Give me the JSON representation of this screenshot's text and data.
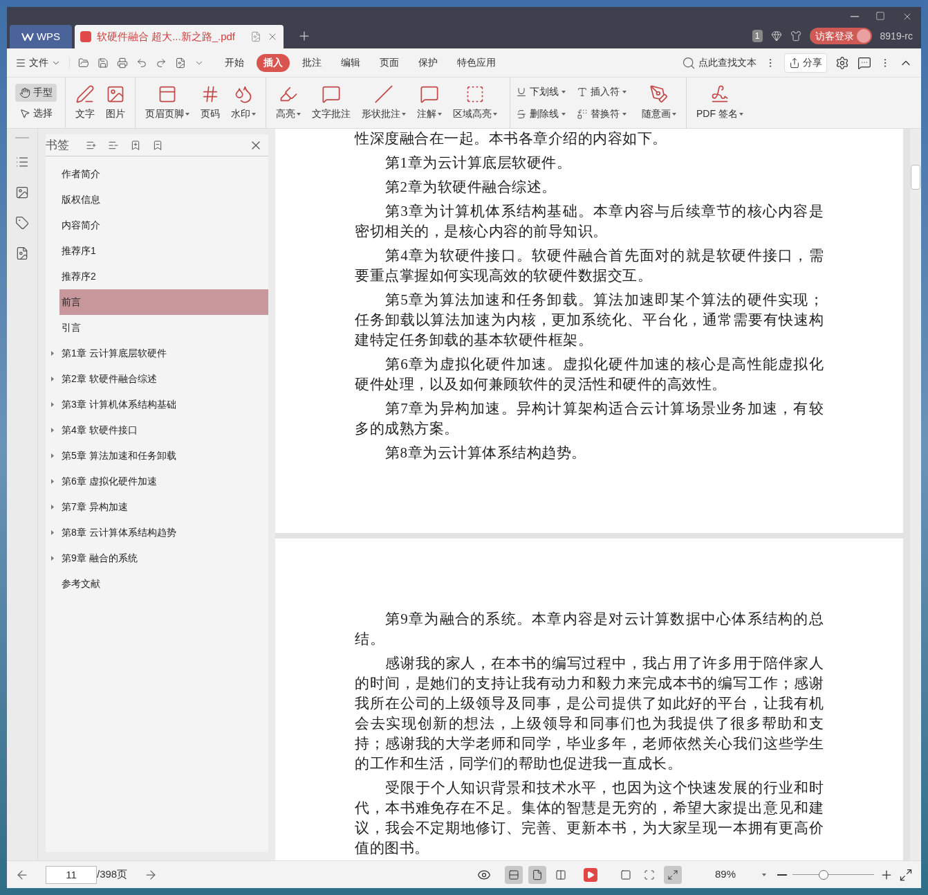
{
  "tabs": [
    {
      "label": "WPS",
      "kind": "home",
      "selected": false
    },
    {
      "label": "软硬件融合 超大...新之路_.pdf",
      "kind": "doc",
      "selected": true
    }
  ],
  "header": {
    "window_count": "1",
    "login": "访客登录",
    "user": "8919-rc"
  },
  "menu": {
    "file": "文件",
    "tabs": [
      {
        "label": "开始",
        "selected": false
      },
      {
        "label": "插入",
        "selected": true
      },
      {
        "label": "批注",
        "selected": false
      },
      {
        "label": "编辑",
        "selected": false
      },
      {
        "label": "页面",
        "selected": false
      },
      {
        "label": "保护",
        "selected": false
      },
      {
        "label": "特色应用",
        "selected": false
      }
    ],
    "search": "点此查找文本",
    "share": "分享"
  },
  "ribbon": [
    {
      "kind": "modes",
      "items": [
        {
          "label": "手型",
          "selected": true
        },
        {
          "label": "选择",
          "selected": false
        }
      ]
    },
    {
      "kind": "big",
      "items": [
        {
          "label": "文字",
          "dropdown": false
        },
        {
          "label": "图片",
          "dropdown": false
        }
      ]
    },
    {
      "kind": "big",
      "items": [
        {
          "label": "页眉页脚",
          "dropdown": true
        },
        {
          "label": "页码",
          "dropdown": false
        },
        {
          "label": "水印",
          "dropdown": true
        }
      ]
    },
    {
      "kind": "big",
      "items": [
        {
          "label": "高亮",
          "dropdown": true
        },
        {
          "label": "文字批注",
          "dropdown": false
        },
        {
          "label": "形状批注",
          "dropdown": true
        },
        {
          "label": "注解",
          "dropdown": true
        },
        {
          "label": "区域高亮",
          "dropdown": true
        }
      ]
    },
    {
      "kind": "small",
      "items": [
        {
          "label": "下划线",
          "dropdown": true
        },
        {
          "label": "删除线",
          "dropdown": true
        }
      ]
    },
    {
      "kind": "small",
      "items": [
        {
          "label": "插入符",
          "dropdown": true
        },
        {
          "label": "替换符",
          "dropdown": true
        }
      ]
    },
    {
      "kind": "big",
      "items": [
        {
          "label": "随意画",
          "dropdown": true
        }
      ]
    },
    {
      "kind": "big",
      "items": [
        {
          "label": "PDF 签名",
          "dropdown": true
        }
      ]
    }
  ],
  "bookmarks": {
    "title": "书签",
    "items": [
      {
        "label": "作者简介",
        "expandable": false,
        "selected": false
      },
      {
        "label": "版权信息",
        "expandable": false,
        "selected": false
      },
      {
        "label": "内容简介",
        "expandable": false,
        "selected": false
      },
      {
        "label": "推荐序1",
        "expandable": false,
        "selected": false
      },
      {
        "label": "推荐序2",
        "expandable": false,
        "selected": false
      },
      {
        "label": "前言",
        "expandable": false,
        "selected": true
      },
      {
        "label": "引言",
        "expandable": false,
        "selected": false
      },
      {
        "label": "第1章 云计算底层软硬件",
        "expandable": true,
        "selected": false
      },
      {
        "label": "第2章 软硬件融合综述",
        "expandable": true,
        "selected": false
      },
      {
        "label": "第3章 计算机体系结构基础",
        "expandable": true,
        "selected": false
      },
      {
        "label": "第4章 软硬件接口",
        "expandable": true,
        "selected": false
      },
      {
        "label": "第5章 算法加速和任务卸载",
        "expandable": true,
        "selected": false
      },
      {
        "label": "第6章 虚拟化硬件加速",
        "expandable": true,
        "selected": false
      },
      {
        "label": "第7章 异构加速",
        "expandable": true,
        "selected": false
      },
      {
        "label": "第8章 云计算体系结构趋势",
        "expandable": true,
        "selected": false
      },
      {
        "label": "第9章 融合的系统",
        "expandable": true,
        "selected": false
      },
      {
        "label": "参考文献",
        "expandable": false,
        "selected": false
      }
    ]
  },
  "pages": [
    {
      "paragraphs": [
        {
          "text": "性深度融合在一起。本书各章介绍的内容如下。",
          "indent": false
        },
        {
          "text": "第1章为云计算底层软硬件。",
          "indent": true
        },
        {
          "text": "第2章为软硬件融合综述。",
          "indent": true
        },
        {
          "text": "第3章为计算机体系结构基础。本章内容与后续章节的核心内容是密切相关的，是核心内容的前导知识。",
          "indent": true
        },
        {
          "text": "第4章为软硬件接口。软硬件融合首先面对的就是软硬件接口，需要重点掌握如何实现高效的软硬件数据交互。",
          "indent": true
        },
        {
          "text": "第5章为算法加速和任务卸载。算法加速即某个算法的硬件实现；任务卸载以算法加速为内核，更加系统化、平台化，通常需要有快速构建特定任务卸载的基本软硬件框架。",
          "indent": true
        },
        {
          "text": "第6章为虚拟化硬件加速。虚拟化硬件加速的核心是高性能虚拟化硬件处理，以及如何兼顾软件的灵活性和硬件的高效性。",
          "indent": true
        },
        {
          "text": "第7章为异构加速。异构计算架构适合云计算场景业务加速，有较多的成熟方案。",
          "indent": true
        },
        {
          "text": "第8章为云计算体系结构趋势。",
          "indent": true
        }
      ]
    },
    {
      "paragraphs": [
        {
          "text": "第9章为融合的系统。本章内容是对云计算数据中心体系结构的总结。",
          "indent": true
        },
        {
          "text": "感谢我的家人，在本书的编写过程中，我占用了许多用于陪伴家人的时间，是她们的支持让我有动力和毅力来完成本书的编写工作；感谢我所在公司的上级领导及同事，是公司提供了如此好的平台，让我有机会去实现创新的想法，上级领导和同事们也为我提供了很多帮助和支持；感谢我的大学老师和同学，毕业多年，老师依然关心我们这些学生的工作和生活，同学们的帮助也促进我一直成长。",
          "indent": true
        },
        {
          "text": "受限于个人知识背景和技术水平，也因为这个快速发展的行业和时代，本书难免存在不足。集体的智慧是无穷的，希望大家提出意见和建议，我会不定期地修订、完善、更新本书，为大家呈现一本拥有更高价值的图书。",
          "indent": true
        }
      ]
    }
  ],
  "status_bar": {
    "page": "11",
    "total": "/398页",
    "view_modes": [
      {
        "selected": true
      },
      {
        "selected": true
      },
      {
        "selected": false
      }
    ],
    "fit_modes": [
      {
        "selected": false
      },
      {
        "selected": false
      },
      {
        "selected": true
      }
    ],
    "zoom": "89%",
    "zoom_slider": {
      "level": 0.38
    }
  }
}
